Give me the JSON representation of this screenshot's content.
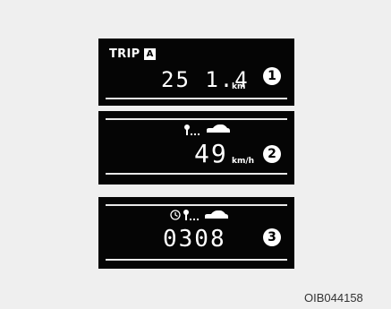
{
  "panels": [
    {
      "trip_label": "TRIP",
      "trip_badge": "A",
      "value": "25 1.4",
      "unit": "km",
      "marker": "1"
    },
    {
      "value": "49",
      "unit": "km/h",
      "marker": "2",
      "icons": [
        "key-icon",
        "car-icon"
      ]
    },
    {
      "value": "0308",
      "marker": "3",
      "icons": [
        "clock-icon",
        "key-icon",
        "car-icon"
      ]
    }
  ],
  "caption": "OIB044158"
}
